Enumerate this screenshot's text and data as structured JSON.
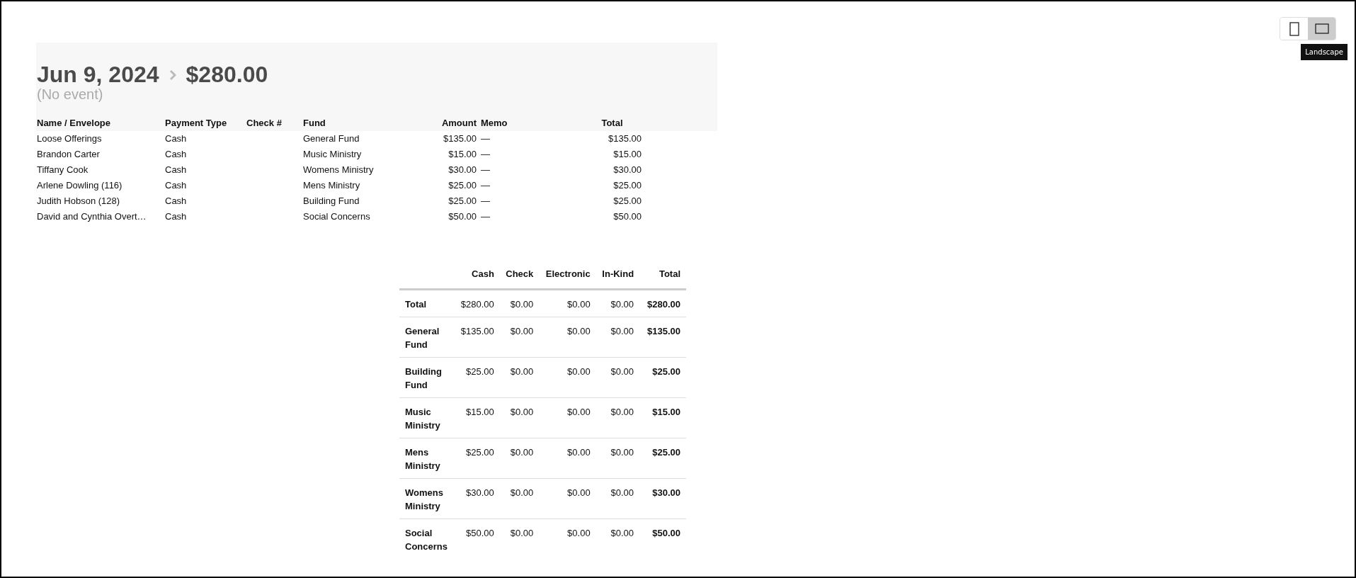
{
  "view_toggle": {
    "buttons": [
      {
        "kind": "portrait",
        "selected": false
      },
      {
        "kind": "landscape",
        "selected": true
      }
    ],
    "tooltip": "Landscape"
  },
  "header": {
    "date": "Jun 9, 2024",
    "amount": "$280.00",
    "event": "(No event)"
  },
  "details": {
    "columns": [
      "Name / Envelope",
      "Payment Type",
      "Check #",
      "Fund",
      "Amount",
      "Memo",
      "Total"
    ],
    "rows": [
      {
        "name": "Loose Offerings",
        "payment_type": "Cash",
        "fund": "General Fund",
        "amount": "$135.00",
        "memo": "—",
        "total": "$135.00"
      },
      {
        "name": "Brandon Carter",
        "payment_type": "Cash",
        "fund": "Music Ministry",
        "amount": "$15.00",
        "memo": "—",
        "total": "$15.00"
      },
      {
        "name": "Tiffany Cook",
        "payment_type": "Cash",
        "fund": "Womens Ministry",
        "amount": "$30.00",
        "memo": "—",
        "total": "$30.00"
      },
      {
        "name": "Arlene Dowling (116)",
        "payment_type": "Cash",
        "fund": "Mens Ministry",
        "amount": "$25.00",
        "memo": "—",
        "total": "$25.00"
      },
      {
        "name": "Judith Hobson (128)",
        "payment_type": "Cash",
        "fund": "Building Fund",
        "amount": "$25.00",
        "memo": "—",
        "total": "$25.00"
      },
      {
        "name": "David and Cynthia Overt…",
        "payment_type": "Cash",
        "fund": "Social Concerns",
        "amount": "$50.00",
        "memo": "—",
        "total": "$50.00"
      }
    ]
  },
  "summary": {
    "columns": [
      "Cash",
      "Check",
      "Electronic",
      "In-Kind",
      "Total"
    ],
    "rows": [
      {
        "label": "Total",
        "values": [
          "$280.00",
          "$0.00",
          "$0.00",
          "$0.00",
          "$280.00"
        ]
      },
      {
        "label": "General Fund",
        "values": [
          "$135.00",
          "$0.00",
          "$0.00",
          "$0.00",
          "$135.00"
        ]
      },
      {
        "label": "Building Fund",
        "values": [
          "$25.00",
          "$0.00",
          "$0.00",
          "$0.00",
          "$25.00"
        ]
      },
      {
        "label": "Music Ministry",
        "values": [
          "$15.00",
          "$0.00",
          "$0.00",
          "$0.00",
          "$15.00"
        ]
      },
      {
        "label": "Mens Ministry",
        "values": [
          "$25.00",
          "$0.00",
          "$0.00",
          "$0.00",
          "$25.00"
        ]
      },
      {
        "label": "Womens Ministry",
        "values": [
          "$30.00",
          "$0.00",
          "$0.00",
          "$0.00",
          "$30.00"
        ]
      },
      {
        "label": "Social Concerns",
        "values": [
          "$50.00",
          "$0.00",
          "$0.00",
          "$0.00",
          "$50.00"
        ]
      }
    ]
  }
}
